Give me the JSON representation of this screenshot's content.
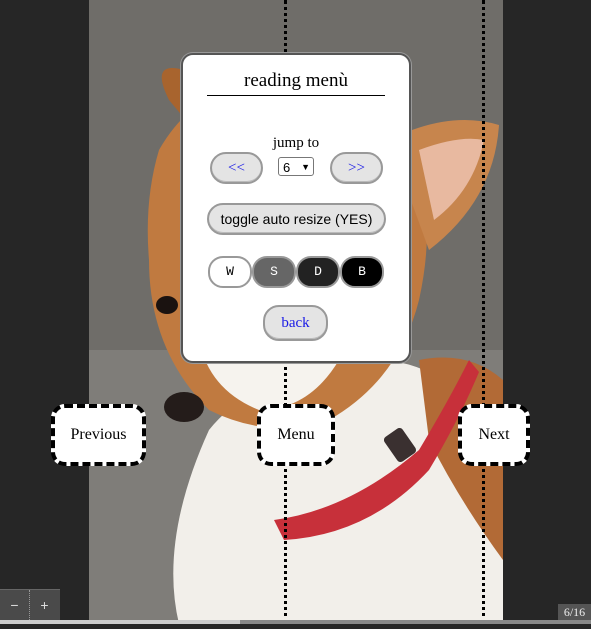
{
  "menu": {
    "title": "reading menù",
    "jump_label": "jump to",
    "prev_label": "<<",
    "next_label": ">>",
    "page_value": "6",
    "resize_label": "toggle auto resize (YES)",
    "themes": [
      "W",
      "S",
      "D",
      "B"
    ],
    "back_label": "back"
  },
  "nav": {
    "previous_label": "Previous",
    "menu_label": "Menu",
    "next_label": "Next"
  },
  "zoom": {
    "minus": "−",
    "plus": "+"
  },
  "page_counter": "6/16",
  "colors": {
    "link": "#1a1ae6",
    "background": "#262626"
  }
}
